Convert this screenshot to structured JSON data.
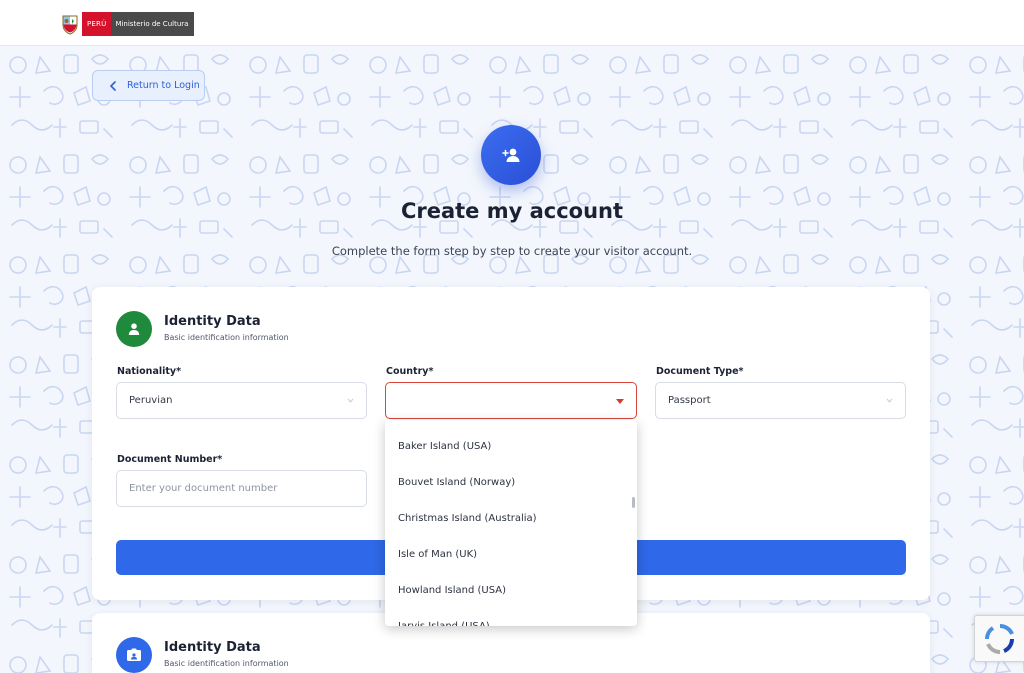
{
  "header": {
    "logo_country": "PERÚ",
    "logo_ministry": "Ministerio de Cultura"
  },
  "back_button": {
    "label": "Return to Login"
  },
  "hero": {
    "title": "Create my account",
    "subtitle": "Complete the form step by step to create your visitor account."
  },
  "identity_section": {
    "title": "Identity Data",
    "subtitle": "Basic identification information",
    "icon": "user-icon",
    "icon_color": "#1f8a3c"
  },
  "form": {
    "nationality": {
      "label": "Nationality*",
      "value": "Peruvian"
    },
    "country": {
      "label": "Country*",
      "value": ""
    },
    "document_type": {
      "label": "Document Type*",
      "value": "Passport"
    },
    "document_number": {
      "label": "Document Number*",
      "placeholder": "Enter your document number"
    }
  },
  "country_dropdown": {
    "options": [
      "Baker Island (USA)",
      "Bouvet Island (Norway)",
      "Christmas Island (Australia)",
      "Isle of Man (UK)",
      "Howland Island (USA)",
      "Jarvis Island (USA)"
    ]
  },
  "second_section": {
    "title": "Identity Data",
    "subtitle": "Basic identification information",
    "icon": "id-card-icon",
    "icon_color": "#2f68e8"
  },
  "colors": {
    "primary": "#2f68e8",
    "error": "#d9463b",
    "success": "#1f8a3c"
  }
}
